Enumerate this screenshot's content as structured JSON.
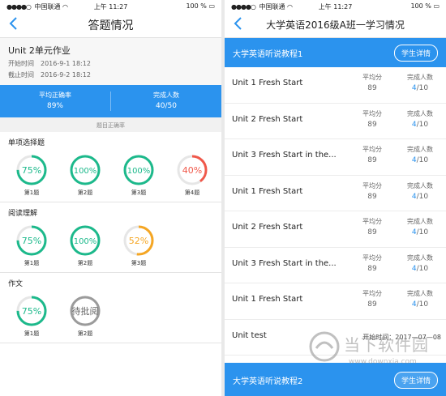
{
  "colors": {
    "accent": "#2b93ee",
    "green": "#1cb98b",
    "red": "#f0584a",
    "orange": "#f5a623",
    "gray": "#9b9b9b"
  },
  "left": {
    "status": {
      "carrier": "中国联通",
      "time": "上午 11:27",
      "battery": "100 %"
    },
    "nav_title": "答题情况",
    "homework": {
      "title": "Unit 2单元作业",
      "start_label": "开始时间",
      "start_value": "2016-9-1 18:12",
      "end_label": "截止时间",
      "end_value": "2016-9-2 18:12"
    },
    "stats": {
      "accuracy_label": "平均正确率",
      "accuracy_value": "89%",
      "completion_label": "完成人数",
      "completion_value": "40/50"
    },
    "subhead": "题目正确率",
    "sections": [
      {
        "title": "单项选择题",
        "items": [
          {
            "text": "75%",
            "percent": 75,
            "color": "green",
            "label": "第1题"
          },
          {
            "text": "100%",
            "percent": 100,
            "color": "green",
            "label": "第2题"
          },
          {
            "text": "100%",
            "percent": 100,
            "color": "green",
            "label": "第3题"
          },
          {
            "text": "40%",
            "percent": 40,
            "color": "red",
            "label": "第4题"
          }
        ]
      },
      {
        "title": "阅读理解",
        "items": [
          {
            "text": "75%",
            "percent": 75,
            "color": "green",
            "label": "第1题"
          },
          {
            "text": "100%",
            "percent": 100,
            "color": "green",
            "label": "第2题"
          },
          {
            "text": "52%",
            "percent": 52,
            "color": "orange",
            "label": "第3题"
          }
        ]
      },
      {
        "title": "作文",
        "items": [
          {
            "text": "75%",
            "percent": 75,
            "color": "green",
            "label": "第1题"
          },
          {
            "text": "待批阅",
            "percent": 100,
            "color": "gray",
            "label": "第2题"
          }
        ]
      }
    ]
  },
  "right": {
    "status": {
      "carrier": "中国联通",
      "time": "上午 11:27",
      "battery": "100 %"
    },
    "nav_title": "大学英语2016级A班一学习情况",
    "course1": {
      "name": "大学英语听说教程1",
      "button": "学生详情"
    },
    "avg_label": "平均分",
    "cnt_label": "完成人数",
    "rows": [
      {
        "name": "Unit 1 Fresh Start",
        "avg": "89",
        "done": "4",
        "total": "/10"
      },
      {
        "name": "Unit 2 Fresh Start",
        "avg": "89",
        "done": "4",
        "total": "/10"
      },
      {
        "name": "Unit 3 Fresh Start in the...",
        "avg": "89",
        "done": "4",
        "total": "/10"
      },
      {
        "name": "Unit 1 Fresh Start",
        "avg": "89",
        "done": "4",
        "total": "/10"
      },
      {
        "name": "Unit 2 Fresh Start",
        "avg": "89",
        "done": "4",
        "total": "/10"
      },
      {
        "name": "Unit 3 Fresh Start in the...",
        "avg": "89",
        "done": "4",
        "total": "/10"
      },
      {
        "name": "Unit 1 Fresh Start",
        "avg": "89",
        "done": "4",
        "total": "/10"
      }
    ],
    "last_row": {
      "name": "Unit test",
      "start": "开始时间：2017—07—08"
    },
    "course2": {
      "name": "大学英语听说教程2",
      "button": "学生详情"
    }
  },
  "watermark": {
    "text": "当下软件园",
    "url": "www.downxia.com"
  }
}
